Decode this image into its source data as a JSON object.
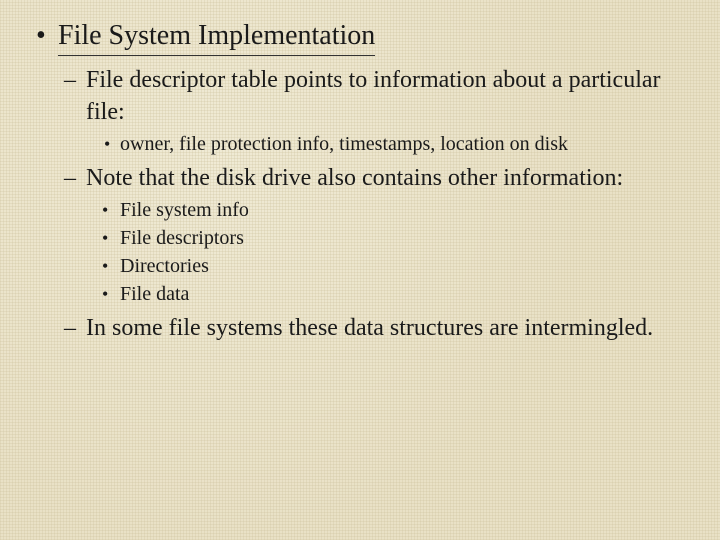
{
  "slide": {
    "title": "File System Implementation",
    "subs": [
      {
        "text": "File descriptor table points to information about a particular file:",
        "points": [
          "owner, file protection info, timestamps, location on disk"
        ]
      },
      {
        "text": "Note that the disk drive also contains other information:",
        "points": [
          "File system info",
          "File descriptors",
          "Directories",
          "File data"
        ]
      },
      {
        "text": "In some file systems these data structures are intermingled.",
        "points": []
      }
    ]
  },
  "markers": {
    "l1": "•",
    "l2": "–",
    "l3": "•",
    "l4": "•"
  }
}
